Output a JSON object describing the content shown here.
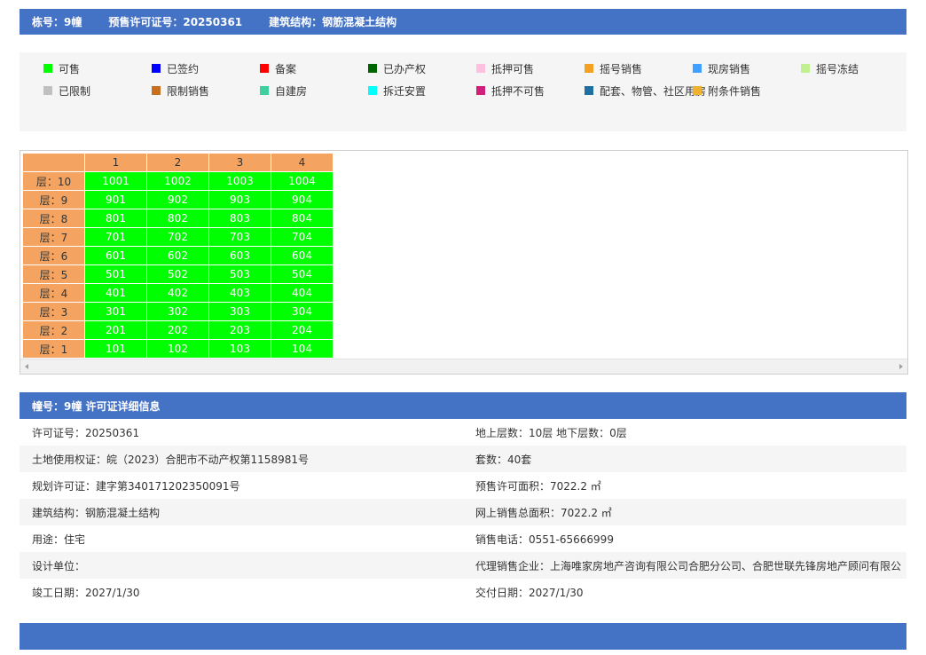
{
  "header": {
    "building": "栋号：9幢",
    "permit": "预售许可证号：20250361",
    "structure": "建筑结构：钢筋混凝土结构"
  },
  "legend": {
    "row1": [
      {
        "label": "可售",
        "color": "#00ff00"
      },
      {
        "label": "已签约",
        "color": "#0000ff"
      },
      {
        "label": "备案",
        "color": "#ff0000"
      },
      {
        "label": "已办产权",
        "color": "#006400"
      },
      {
        "label": "抵押可售",
        "color": "#ffc0e0"
      },
      {
        "label": "摇号销售",
        "color": "#f4a020"
      },
      {
        "label": "现房销售",
        "color": "#3fa0ff"
      },
      {
        "label": "摇号冻结",
        "color": "#c0f090"
      }
    ],
    "row2": [
      {
        "label": "已限制",
        "color": "#c0c0c0"
      },
      {
        "label": "限制销售",
        "color": "#c87020"
      },
      {
        "label": "自建房",
        "color": "#40d0a0"
      },
      {
        "label": "拆迁安置",
        "color": "#00ffff"
      },
      {
        "label": "抵押不可售",
        "color": "#d0207a"
      },
      {
        "label": "配套、物管、社区用房",
        "color": "#1f6fa0"
      },
      {
        "label": "附条件销售",
        "color": "#f0b030"
      }
    ]
  },
  "grid": {
    "columns": [
      "1",
      "2",
      "3",
      "4"
    ],
    "rows": [
      {
        "floor": "层：10",
        "units": [
          "1001",
          "1002",
          "1003",
          "1004"
        ]
      },
      {
        "floor": "层：9",
        "units": [
          "901",
          "902",
          "903",
          "904"
        ]
      },
      {
        "floor": "层：8",
        "units": [
          "801",
          "802",
          "803",
          "804"
        ]
      },
      {
        "floor": "层：7",
        "units": [
          "701",
          "702",
          "703",
          "704"
        ]
      },
      {
        "floor": "层：6",
        "units": [
          "601",
          "602",
          "603",
          "604"
        ]
      },
      {
        "floor": "层：5",
        "units": [
          "501",
          "502",
          "503",
          "504"
        ]
      },
      {
        "floor": "层：4",
        "units": [
          "401",
          "402",
          "403",
          "404"
        ]
      },
      {
        "floor": "层：3",
        "units": [
          "301",
          "302",
          "303",
          "304"
        ]
      },
      {
        "floor": "层：2",
        "units": [
          "201",
          "202",
          "203",
          "204"
        ]
      },
      {
        "floor": "层：1",
        "units": [
          "101",
          "102",
          "103",
          "104"
        ]
      }
    ]
  },
  "detail": {
    "title": "幢号：9幢 许可证详细信息",
    "rows": [
      [
        "许可证号：20250361",
        "地上层数：10层  地下层数：0层"
      ],
      [
        "土地使用权证：皖（2023）合肥市不动产权第1158981号",
        "套数：40套"
      ],
      [
        "规划许可证：建字第340171202350091号",
        "预售许可面积：7022.2 ㎡"
      ],
      [
        "建筑结构：钢筋混凝土结构",
        "网上销售总面积：7022.2 ㎡"
      ],
      [
        "用途：住宅",
        "销售电话：0551-65666999"
      ],
      [
        "设计单位：",
        "代理销售企业：上海唯家房地产咨询有限公司合肥分公司、合肥世联先锋房地产顾问有限公"
      ],
      [
        "竣工日期：2027/1/30",
        "交付日期：2027/1/30"
      ]
    ]
  }
}
